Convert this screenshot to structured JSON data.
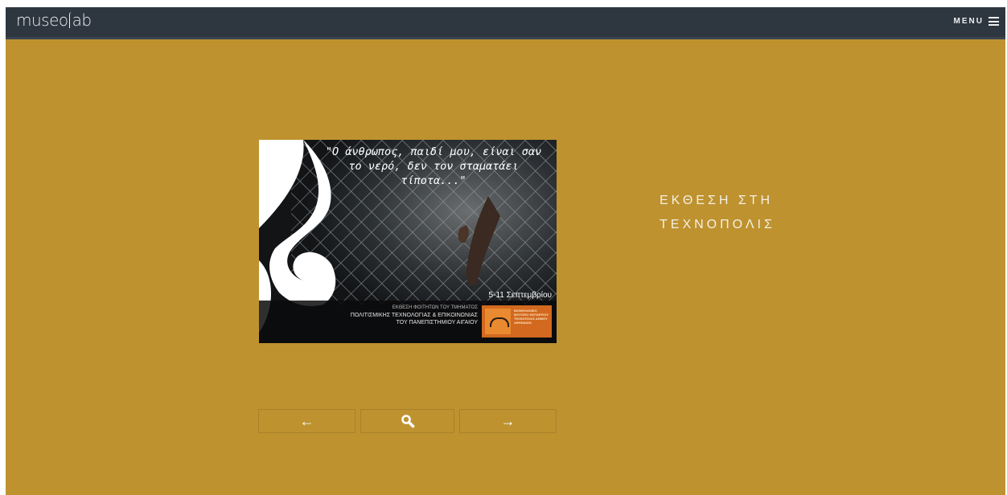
{
  "header": {
    "logo_left": "museo",
    "logo_right": "ab",
    "menu_label": "MENU"
  },
  "artwork": {
    "quote": "\"Ο άνθρωπος, παιδί μου, είναι σαν το νερό, δεν τον σταματάει τίποτα...\"",
    "dates": "5-11 Σεπτεμβρίου",
    "credit_line1": "ΕΚΘΕΣΗ ΦΟΙΤΗΤΩΝ ΤΟΥ ΤΜΗΜΑΤΟΣ",
    "credit_line2": "ΠΟΛΙΤΙΣΜΙΚΗΣ ΤΕΧΝΟΛΟΓΙΑΣ & ΕΠΙΚΟΙΝΩΝΙΑΣ",
    "credit_line3": "ΤΟΥ ΠΑΝΕΠΙΣΤΗΜΙΟΥ ΑΙΓΑΙΟΥ",
    "badge_text": "ΒΙΟΜΗΧΑΝΙΚΟ ΜΟΥΣΕΙΟ ΦΩΤΑΕΡΙΟΥ ΤΕΧΝΟΠΟΛΙΣ ΔΗΜΟΥ ΑΘΗΝΑΙΩΝ"
  },
  "exhibition": {
    "title_line1": "ΕΚΘΕΣΗ ΣΤΗ",
    "title_line2": "ΤΕΧΝΟΠΟΛΙΣ"
  },
  "controls": {
    "prev_symbol": "←",
    "next_symbol": "→",
    "zoom_icon": "magnifier-icon"
  },
  "colors": {
    "background": "#be922f",
    "topbar": "#2e3640",
    "badge": "#d2691e"
  }
}
